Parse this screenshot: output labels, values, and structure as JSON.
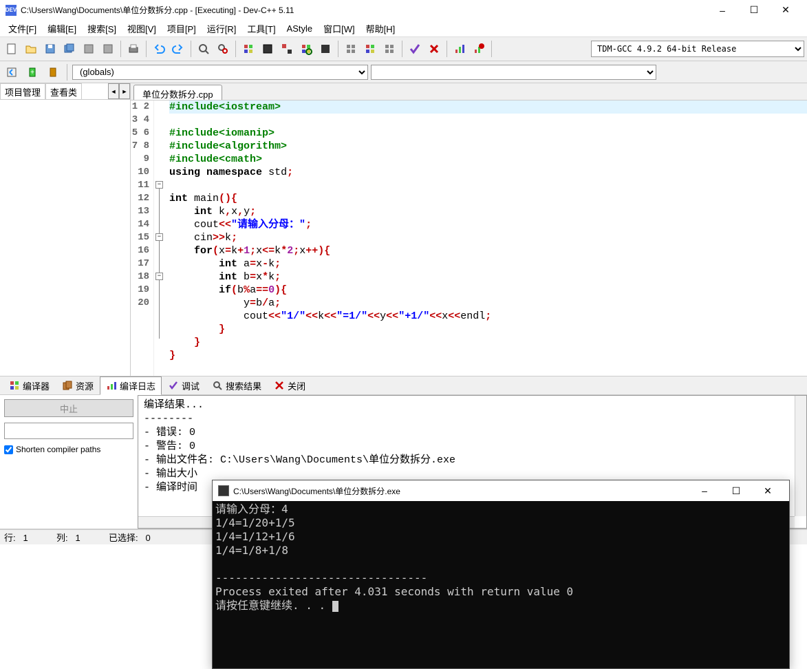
{
  "window": {
    "title": "C:\\Users\\Wang\\Documents\\单位分数拆分.cpp - [Executing] - Dev-C++ 5.11"
  },
  "menu": {
    "file": "文件[F]",
    "edit": "编辑[E]",
    "search": "搜索[S]",
    "view": "视图[V]",
    "project": "项目[P]",
    "run": "运行[R]",
    "tools": "工具[T]",
    "astyle": "AStyle",
    "window": "窗口[W]",
    "help": "帮助[H]"
  },
  "compiler_select": "TDM-GCC 4.9.2 64-bit Release",
  "globals": "(globals)",
  "left_tabs": {
    "project": "项目管理",
    "view": "查看类"
  },
  "file_tab": "单位分数拆分.cpp",
  "code": {
    "l1": "#include<iostream>",
    "l2": "#include<iomanip>",
    "l3": "#include<algorithm>",
    "l4": "#include<cmath>",
    "l5_a": "using",
    "l5_b": "namespace",
    "l5_c": "std",
    "l7_a": "int",
    "l7_b": "main",
    "l8_a": "int",
    "l8_b": "k",
    "l8_c": "x",
    "l8_d": "y",
    "l9_a": "cout",
    "l9_b": "\"请输入分母：\"",
    "l10_a": "cin",
    "l10_b": "k",
    "l11_a": "for",
    "l11_b": "x",
    "l11_c": "k",
    "l11_d": "1",
    "l11_e": "x",
    "l11_f": "k",
    "l11_g": "2",
    "l11_h": "x",
    "l12_a": "int",
    "l12_b": "a",
    "l12_c": "x",
    "l12_d": "k",
    "l13_a": "int",
    "l13_b": "b",
    "l13_c": "x",
    "l13_d": "k",
    "l14_a": "if",
    "l14_b": "b",
    "l14_c": "a",
    "l14_d": "0",
    "l15_a": "y",
    "l15_b": "b",
    "l15_c": "a",
    "l16_a": "cout",
    "l16_s1": "\"1/\"",
    "l16_b": "k",
    "l16_s2": "\"=1/\"",
    "l16_c": "y",
    "l16_s3": "\"+1/\"",
    "l16_d": "x",
    "l16_e": "endl"
  },
  "bottom_tabs": {
    "compiler": "编译器",
    "resources": "资源",
    "compile_log": "编译日志",
    "debug": "调试",
    "search": "搜索结果",
    "close": "关闭"
  },
  "compile": {
    "abort": "中止",
    "shorten": "Shorten compiler paths",
    "log0": "编译结果...",
    "log1": "--------",
    "log2": "- 错误: 0",
    "log3": "- 警告: 0",
    "log4": "- 输出文件名: C:\\Users\\Wang\\Documents\\单位分数拆分.exe",
    "log5": "- 输出大小",
    "log6": "- 编译时间"
  },
  "status": {
    "line_label": "行:",
    "line_val": "1",
    "col_label": "列:",
    "col_val": "1",
    "sel_label": "已选择:",
    "sel_val": "0"
  },
  "console": {
    "title": "C:\\Users\\Wang\\Documents\\单位分数拆分.exe",
    "l1": "请输入分母：4",
    "l2": "1/4=1/20+1/5",
    "l3": "1/4=1/12+1/6",
    "l4": "1/4=1/8+1/8",
    "sep": "--------------------------------",
    "exit": "Process exited after 4.031 seconds with return value 0",
    "cont": "请按任意键继续. . . "
  }
}
